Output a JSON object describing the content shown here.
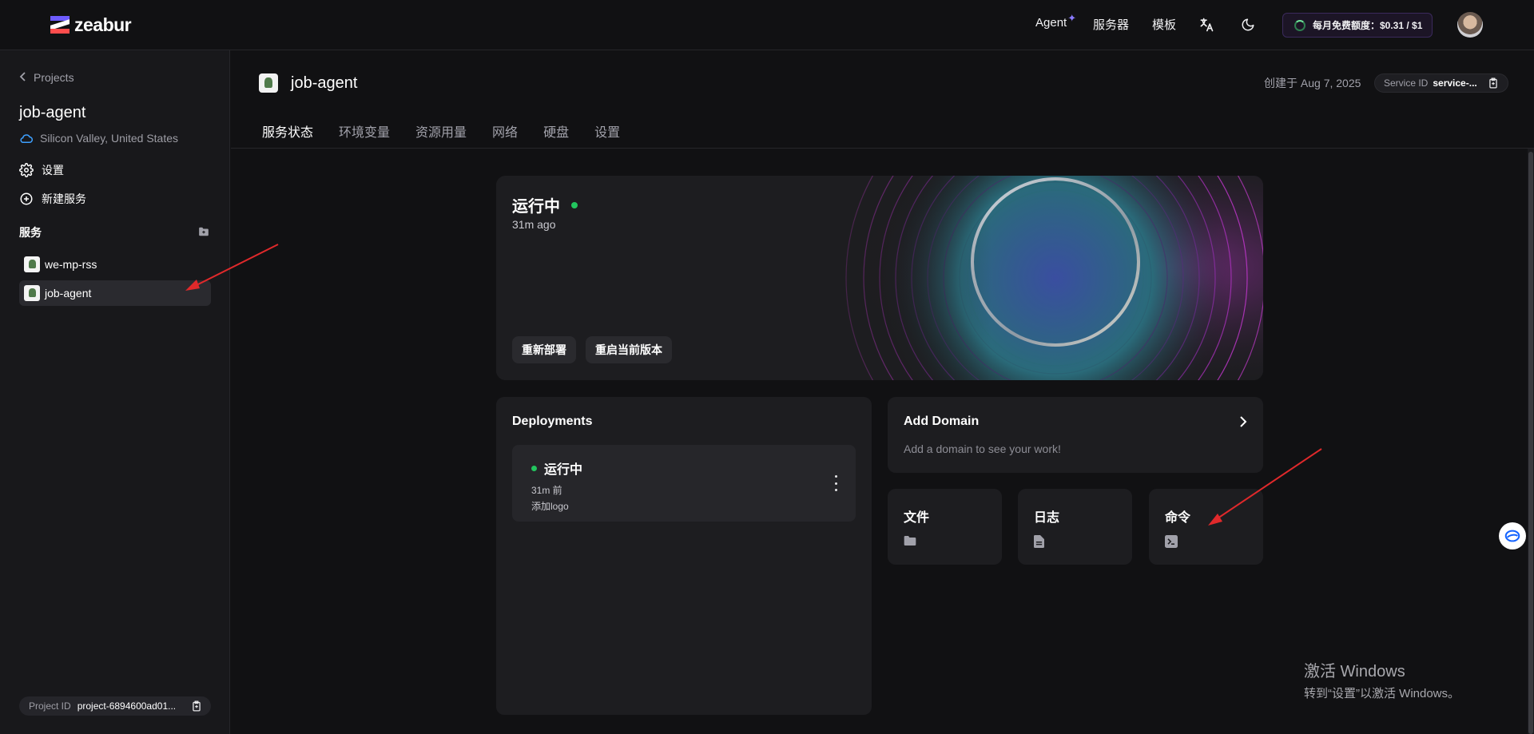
{
  "topbar": {
    "brand": "zeabur",
    "nav": {
      "agent": "Agent",
      "agent_star": "✦",
      "servers": "服务器",
      "templates": "模板"
    },
    "credit": "每月免费额度：$0.31 / $1"
  },
  "sidebar": {
    "back": "Projects",
    "project_name": "job-agent",
    "region": "Silicon Valley, United States",
    "settings": "设置",
    "new_service": "新建服务",
    "services_label": "服务",
    "services": [
      {
        "name": "we-mp-rss"
      },
      {
        "name": "job-agent"
      }
    ],
    "project_id_label": "Project ID",
    "project_id_value": "project-6894600ad01..."
  },
  "header": {
    "service_name": "job-agent",
    "created": "创建于 Aug 7, 2025",
    "service_id_label": "Service ID",
    "service_id_value": "service-..."
  },
  "tabs": [
    "服务状态",
    "环境变量",
    "资源用量",
    "网络",
    "硬盘",
    "设置"
  ],
  "hero": {
    "status": "运行中",
    "time": "31m ago",
    "redeploy": "重新部署",
    "restart": "重启当前版本"
  },
  "deployments": {
    "title": "Deployments",
    "item": {
      "status": "运行中",
      "ago": "31m 前",
      "message": "添加logo"
    }
  },
  "domain": {
    "title": "Add Domain",
    "subtitle": "Add a domain to see your work!"
  },
  "shortcuts": {
    "files": "文件",
    "logs": "日志",
    "command": "命令"
  },
  "watermark": {
    "line1": "激活 Windows",
    "line2": "转到“设置”以激活 Windows。"
  },
  "colors": {
    "accent": "#6d5bff",
    "running": "#22c55e",
    "annotation_arrow": "#e0292b"
  },
  "icons": [
    "translate-icon",
    "moon-icon",
    "gear-icon",
    "plus-circle-icon",
    "folder-icon",
    "file-text-icon",
    "terminal-icon",
    "chevron-right-icon",
    "copy-icon",
    "cloud-icon"
  ]
}
